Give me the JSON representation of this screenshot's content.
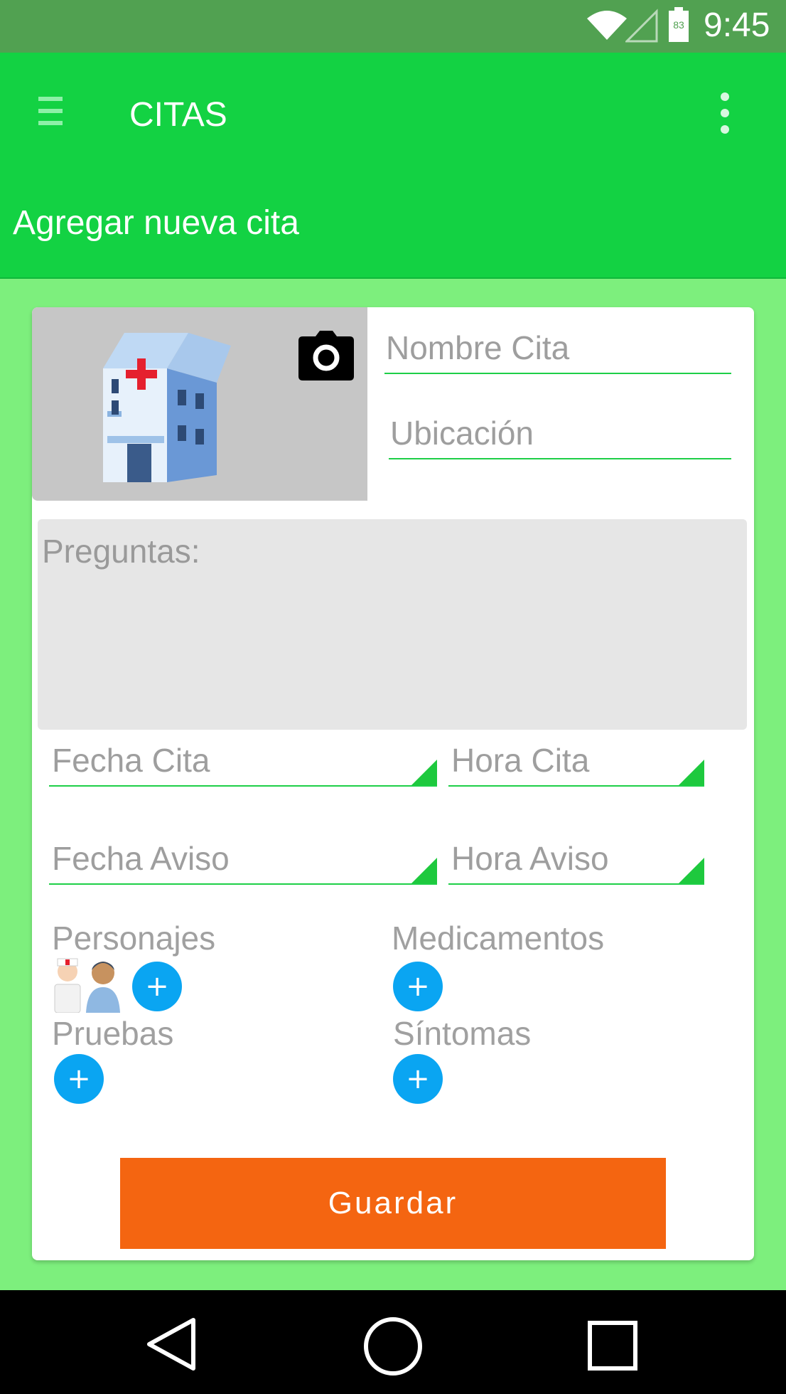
{
  "status_bar": {
    "time": "9:45",
    "battery_level": "83",
    "icons": [
      "wifi-icon",
      "signal-icon",
      "battery-icon"
    ]
  },
  "toolbar": {
    "title": "CITAS",
    "menu_icon": "hamburger-menu-icon",
    "overflow_icon": "more-vert-icon"
  },
  "subheader": {
    "title": "Agregar nueva cita"
  },
  "form": {
    "nombre_placeholder": "Nombre Cita",
    "ubicacion_placeholder": "Ubicación",
    "preguntas_placeholder": "Preguntas:",
    "fecha_cita": "Fecha Cita",
    "hora_cita": "Hora Cita",
    "fecha_aviso": "Fecha Aviso",
    "hora_aviso": "Hora Aviso",
    "personajes_label": "Personajes",
    "medicamentos_label": "Medicamentos",
    "pruebas_label": "Pruebas",
    "sintomas_label": "Síntomas",
    "add_symbol": "+",
    "save_label": "Guardar"
  },
  "colors": {
    "status_bar": "#51A151",
    "toolbar": "#13D243",
    "background": "#7DEF7D",
    "accent_line": "#1ECF47",
    "add_button": "#0AA5F2",
    "save_button": "#F46511"
  }
}
